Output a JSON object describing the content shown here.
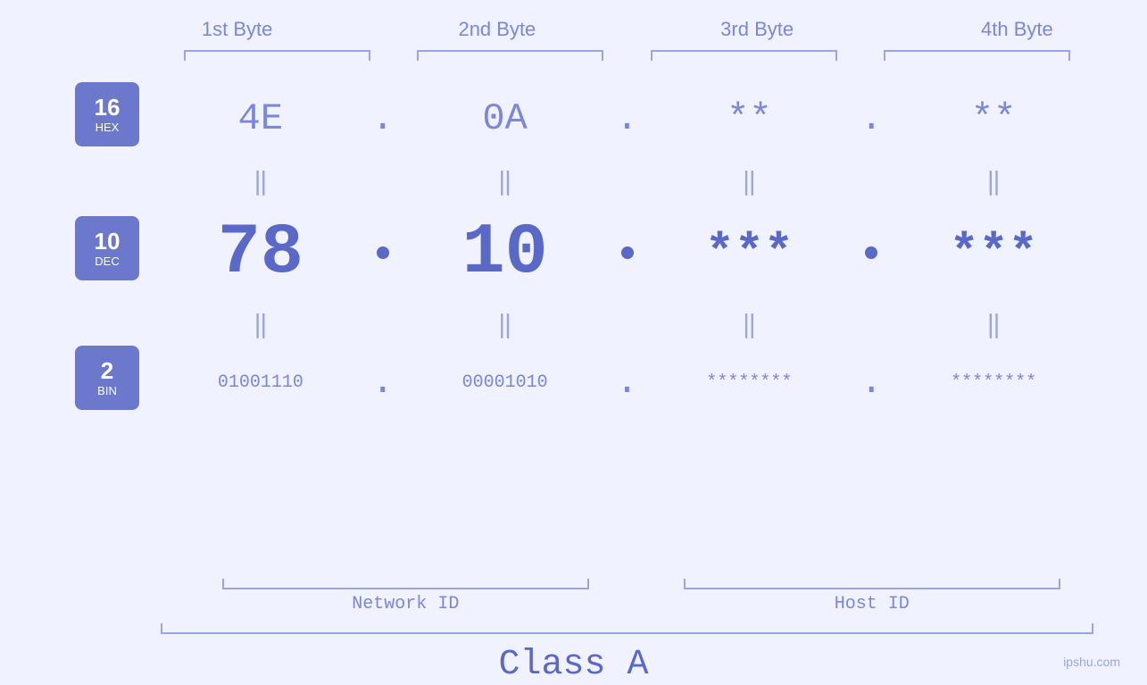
{
  "header": {
    "bytes": [
      "1st Byte",
      "2nd Byte",
      "3rd Byte",
      "4th Byte"
    ]
  },
  "badges": [
    {
      "num": "16",
      "label": "HEX"
    },
    {
      "num": "10",
      "label": "DEC"
    },
    {
      "num": "2",
      "label": "BIN"
    }
  ],
  "columns": [
    {
      "hex": "4E",
      "dec": "78",
      "bin": "01001110",
      "masked": false
    },
    {
      "hex": "0A",
      "dec": "10",
      "bin": "00001010",
      "masked": false
    },
    {
      "hex": "**",
      "dec": "***",
      "bin": "********",
      "masked": true
    },
    {
      "hex": "**",
      "dec": "***",
      "bin": "********",
      "masked": true
    }
  ],
  "labels": {
    "networkId": "Network ID",
    "hostId": "Host ID",
    "classA": "Class A",
    "watermark": "ipshu.com"
  },
  "colors": {
    "accent": "#5a68c8",
    "light": "#7b87d9",
    "lighter": "#9ba5e0",
    "bg": "#f0f2ff",
    "badge": "#6b78cc",
    "white": "#ffffff"
  }
}
